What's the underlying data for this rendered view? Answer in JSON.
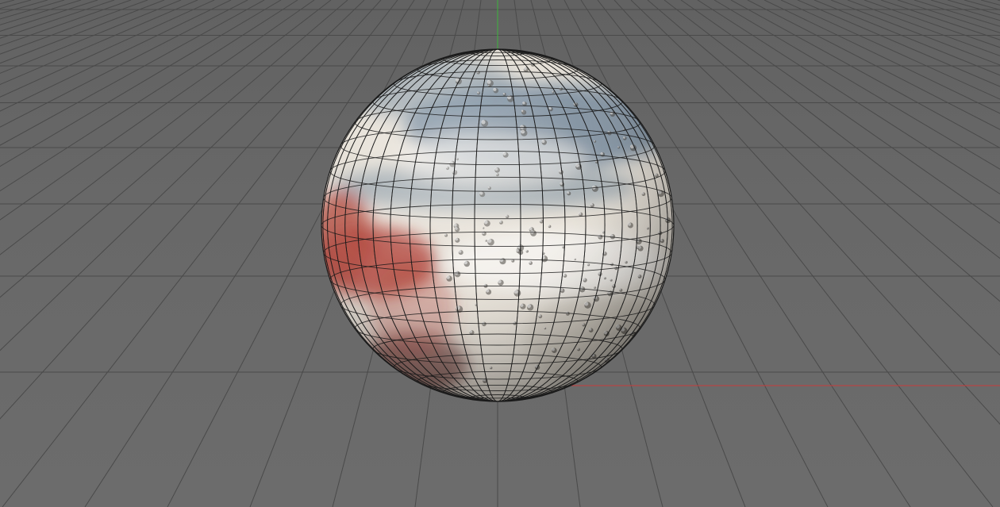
{
  "viewport": {
    "background_color": "#686868",
    "grid_color": "#4a4a4a",
    "axis_x_color": "#c83c3c",
    "axis_y_color": "#3cb43c",
    "grid_visible": true
  },
  "sphere": {
    "object": "textured-sphere",
    "wireframe_overlay": true,
    "wire_color": "#1a1a1a",
    "texture_colors": {
      "cream": "#e6e0d6",
      "blue_gray": "#6f8396",
      "red": "#b0433a",
      "dark_red": "#6b3a36"
    }
  }
}
